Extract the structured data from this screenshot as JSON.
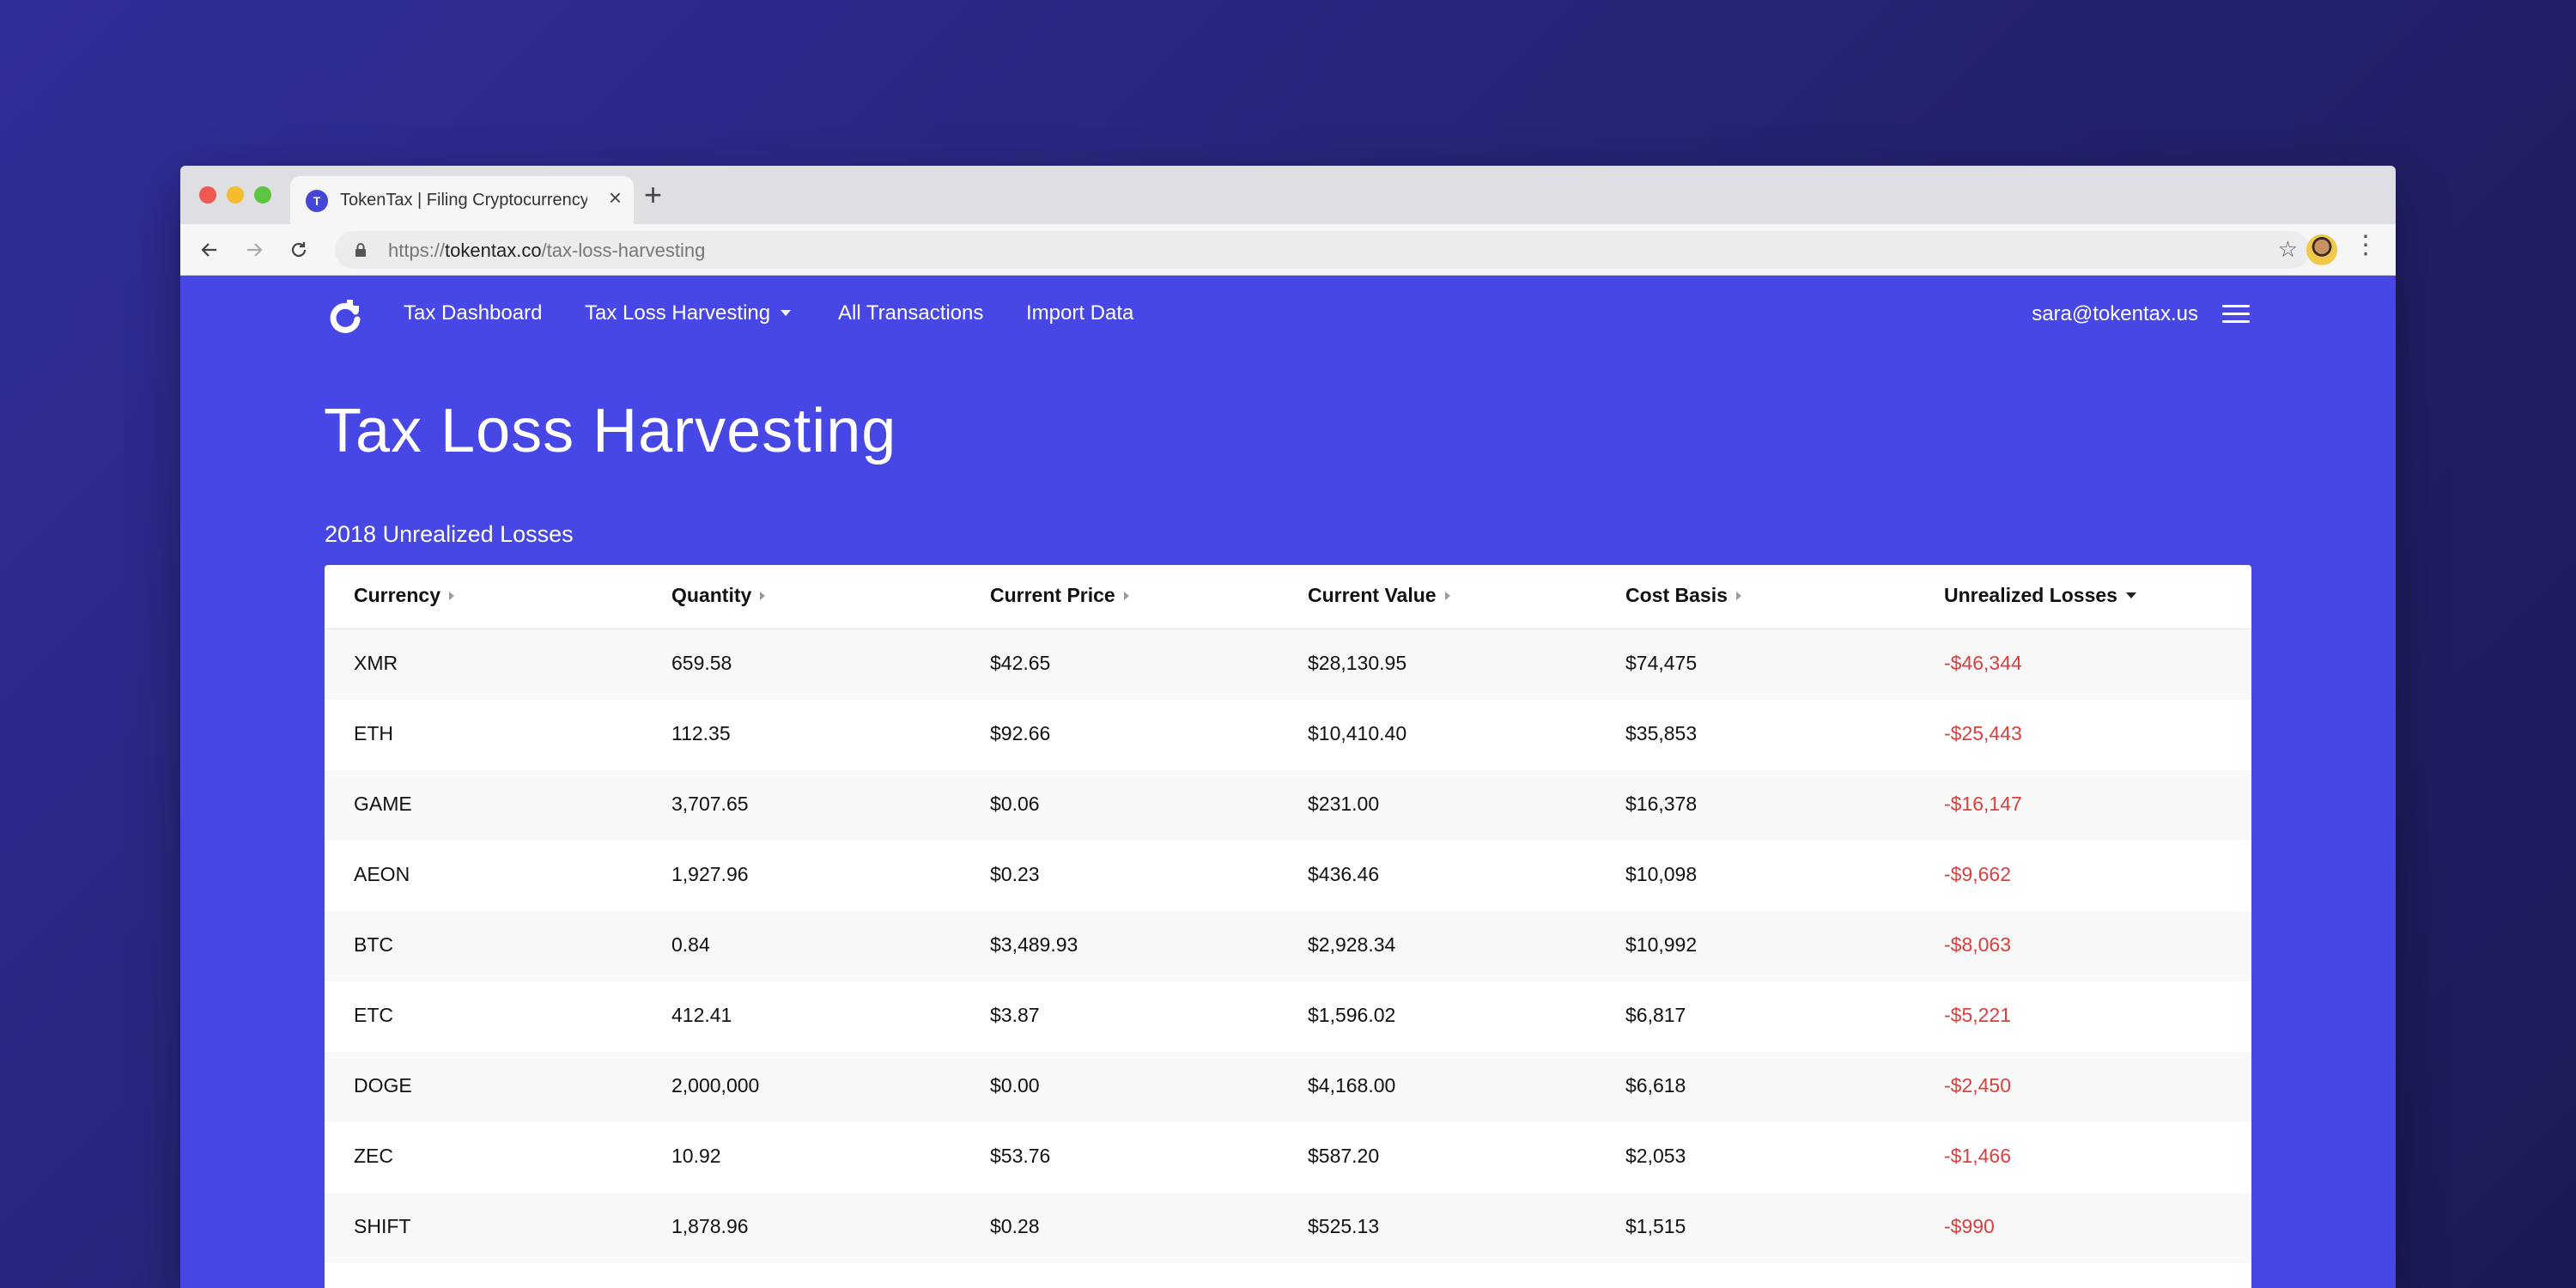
{
  "browser": {
    "tab_title": "TokenTax | Filing Cryptocurrency Taxes",
    "favicon_letter": "T",
    "url_scheme": "https://",
    "url_host": "tokentax.co",
    "url_path": "/tax-loss-harvesting"
  },
  "nav": {
    "links": [
      "Tax Dashboard",
      "Tax Loss Harvesting",
      "All Transactions",
      "Import Data"
    ],
    "user_email": "sara@tokentax.us"
  },
  "page": {
    "title": "Tax Loss Harvesting",
    "section_title": "2018 Unrealized Losses"
  },
  "table": {
    "headers": [
      "Currency",
      "Quantity",
      "Current Price",
      "Current Value",
      "Cost Basis",
      "Unrealized Losses"
    ],
    "rows": [
      [
        "XMR",
        "659.58",
        "$42.65",
        "$28,130.95",
        "$74,475",
        "-$46,344"
      ],
      [
        "ETH",
        "112.35",
        "$92.66",
        "$10,410.40",
        "$35,853",
        "-$25,443"
      ],
      [
        "GAME",
        "3,707.65",
        "$0.06",
        "$231.00",
        "$16,378",
        "-$16,147"
      ],
      [
        "AEON",
        "1,927.96",
        "$0.23",
        "$436.46",
        "$10,098",
        "-$9,662"
      ],
      [
        "BTC",
        "0.84",
        "$3,489.93",
        "$2,928.34",
        "$10,992",
        "-$8,063"
      ],
      [
        "ETC",
        "412.41",
        "$3.87",
        "$1,596.02",
        "$6,817",
        "-$5,221"
      ],
      [
        "DOGE",
        "2,000,000",
        "$0.00",
        "$4,168.00",
        "$6,618",
        "-$2,450"
      ],
      [
        "ZEC",
        "10.92",
        "$53.76",
        "$587.20",
        "$2,053",
        "-$1,466"
      ],
      [
        "SHIFT",
        "1,878.96",
        "$0.28",
        "$525.13",
        "$1,515",
        "-$990"
      ]
    ]
  },
  "colors": {
    "brand": "#4747e5",
    "loss": "#d8413e"
  }
}
